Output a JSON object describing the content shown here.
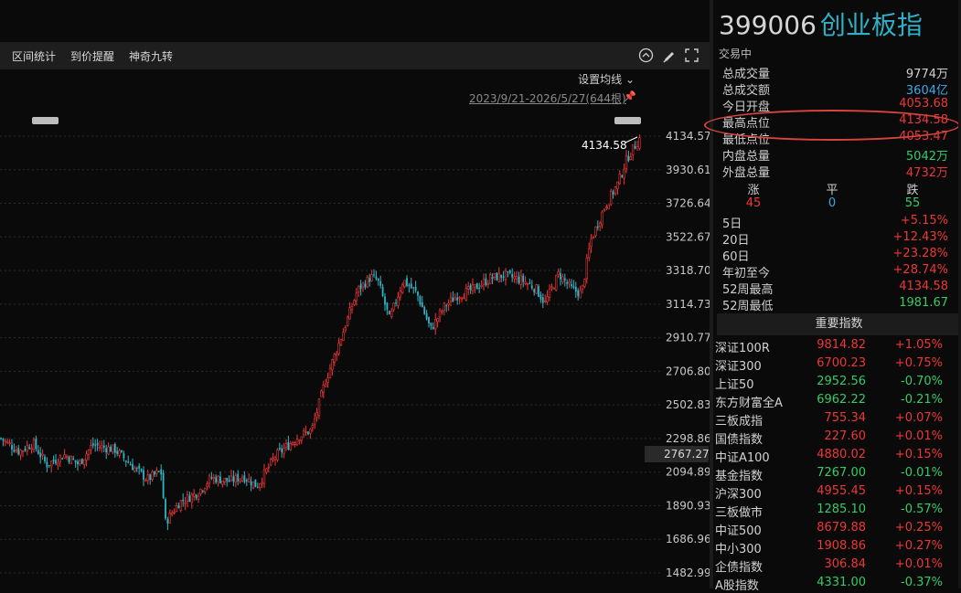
{
  "toolbar": {
    "items": [
      "区间统计",
      "到价提醒",
      "神奇九转"
    ],
    "icons": [
      "collapse-icon",
      "draw-icon",
      "fullscreen-icon"
    ]
  },
  "chart": {
    "ma_setting": "设置均线",
    "range": "2023/9/21-2026/5/27(644根)",
    "max_label": "4134.58",
    "current_price": "2767.27",
    "accent_up": "#ee3636",
    "accent_down": "#2fb5c8"
  },
  "chart_data": {
    "type": "candlestick",
    "y_ticks": [
      4134.57,
      3930.61,
      3726.64,
      3522.67,
      3318.7,
      3114.73,
      2910.77,
      2706.8,
      2502.83,
      2298.86,
      2094.89,
      1890.93,
      1686.96,
      1482.99
    ],
    "y_tick_labels": [
      "4134.57",
      "3930.61",
      "3726.64",
      "3522.67",
      "3318.70",
      "3114.73",
      "2910.77",
      "2706.80",
      "2502.83",
      "2298.86",
      "2094.89",
      "1890.93",
      "1686.96",
      "1482.99"
    ],
    "ylim": [
      1482.99,
      4134.57
    ],
    "anchors": [
      [
        0,
        2300
      ],
      [
        20,
        2220
      ],
      [
        35,
        2270
      ],
      [
        50,
        2140
      ],
      [
        70,
        2200
      ],
      [
        85,
        2140
      ],
      [
        100,
        2260
      ],
      [
        125,
        2230
      ],
      [
        140,
        2150
      ],
      [
        160,
        2050
      ],
      [
        175,
        2100
      ],
      [
        180,
        1790
      ],
      [
        195,
        1910
      ],
      [
        215,
        1970
      ],
      [
        230,
        2060
      ],
      [
        250,
        2040
      ],
      [
        265,
        2070
      ],
      [
        280,
        2010
      ],
      [
        300,
        2190
      ],
      [
        325,
        2310
      ],
      [
        340,
        2350
      ],
      [
        355,
        2650
      ],
      [
        370,
        2880
      ],
      [
        390,
        3200
      ],
      [
        405,
        3280
      ],
      [
        412,
        3260
      ],
      [
        425,
        3020
      ],
      [
        440,
        3260
      ],
      [
        455,
        3180
      ],
      [
        470,
        2960
      ],
      [
        485,
        3100
      ],
      [
        500,
        3170
      ],
      [
        515,
        3200
      ],
      [
        535,
        3270
      ],
      [
        550,
        3290
      ],
      [
        570,
        3260
      ],
      [
        585,
        3210
      ],
      [
        595,
        3120
      ],
      [
        610,
        3300
      ],
      [
        625,
        3200
      ],
      [
        635,
        3180
      ],
      [
        645,
        3500
      ],
      [
        660,
        3700
      ],
      [
        675,
        3850
      ],
      [
        685,
        4000
      ],
      [
        700,
        4134.58
      ]
    ],
    "max": 4134.58,
    "last": 2767.27
  },
  "quote": {
    "code": "399006",
    "name": "创业板指",
    "status": "交易中",
    "stats": [
      {
        "label": "总成交量",
        "value": "9774万",
        "color": "white"
      },
      {
        "label": "总成交额",
        "value": "3604亿",
        "color": "blue"
      },
      {
        "label": "今日开盘",
        "value": "4053.68",
        "color": "red"
      },
      {
        "label": "最高点位",
        "value": "4134.58",
        "color": "red"
      },
      {
        "label": "最低点位",
        "value": "4053.47",
        "color": "red"
      },
      {
        "label": "内盘总量",
        "value": "5042万",
        "color": "green"
      },
      {
        "label": "外盘总量",
        "value": "4732万",
        "color": "red"
      }
    ],
    "updown": {
      "labels": [
        "涨",
        "平",
        "跌"
      ],
      "values": [
        "45",
        "0",
        "55"
      ]
    },
    "perf": [
      {
        "label": "5日",
        "value": "+5.15%",
        "color": "red"
      },
      {
        "label": "20日",
        "value": "+12.43%",
        "color": "red"
      },
      {
        "label": "60日",
        "value": "+23.28%",
        "color": "red"
      },
      {
        "label": "年初至今",
        "value": "+28.74%",
        "color": "red"
      },
      {
        "label": "52周最高",
        "value": "4134.58",
        "color": "red"
      },
      {
        "label": "52周最低",
        "value": "1981.67",
        "color": "green"
      }
    ]
  },
  "indices_title": "重要指数",
  "indices": [
    {
      "name": "深证100R",
      "price": "9814.82",
      "change": "+1.05%",
      "color": "red"
    },
    {
      "name": "深证300",
      "price": "6700.23",
      "change": "+0.75%",
      "color": "red"
    },
    {
      "name": "上证50",
      "price": "2952.56",
      "change": "-0.70%",
      "color": "green"
    },
    {
      "name": "东方财富全A",
      "price": "6962.22",
      "change": "-0.21%",
      "color": "green"
    },
    {
      "name": "三板成指",
      "price": "755.34",
      "change": "+0.07%",
      "color": "red"
    },
    {
      "name": "国债指数",
      "price": "227.60",
      "change": "+0.01%",
      "color": "red"
    },
    {
      "name": "中证A100",
      "price": "4880.02",
      "change": "+0.15%",
      "color": "red"
    },
    {
      "name": "基金指数",
      "price": "7267.00",
      "change": "-0.01%",
      "color": "green"
    },
    {
      "name": "沪深300",
      "price": "4955.45",
      "change": "+0.15%",
      "color": "red"
    },
    {
      "name": "三板做市",
      "price": "1285.10",
      "change": "-0.57%",
      "color": "green"
    },
    {
      "name": "中证500",
      "price": "8679.88",
      "change": "+0.25%",
      "color": "red"
    },
    {
      "name": "中小300",
      "price": "1908.86",
      "change": "+0.27%",
      "color": "red"
    },
    {
      "name": "企债指数",
      "price": "306.84",
      "change": "+0.01%",
      "color": "red"
    },
    {
      "name": "A股指数",
      "price": "4331.00",
      "change": "-0.37%",
      "color": "green"
    }
  ]
}
